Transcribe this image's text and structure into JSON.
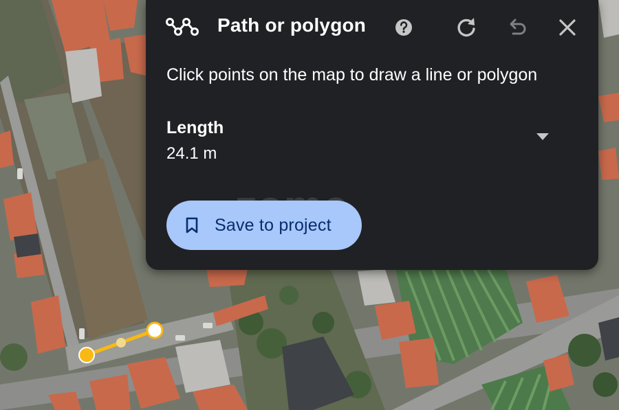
{
  "panel": {
    "title": "Path or polygon",
    "instructions": "Click points on the map to draw a line or polygon",
    "metric": {
      "label": "Length",
      "value": "24.1 m"
    },
    "save_button": "Save to project",
    "watermark": "zome"
  },
  "icons": {
    "path": "path-polyline-icon",
    "help": "help-circle-icon",
    "redo": "redo-icon",
    "undo": "undo-icon",
    "close": "close-icon",
    "caret": "caret-down-icon",
    "bookmark": "bookmark-icon"
  },
  "colors": {
    "panel_bg": "#202124",
    "button_bg": "#a8c7fa",
    "button_text": "#062e6f",
    "measure_line": "#f9b915"
  }
}
